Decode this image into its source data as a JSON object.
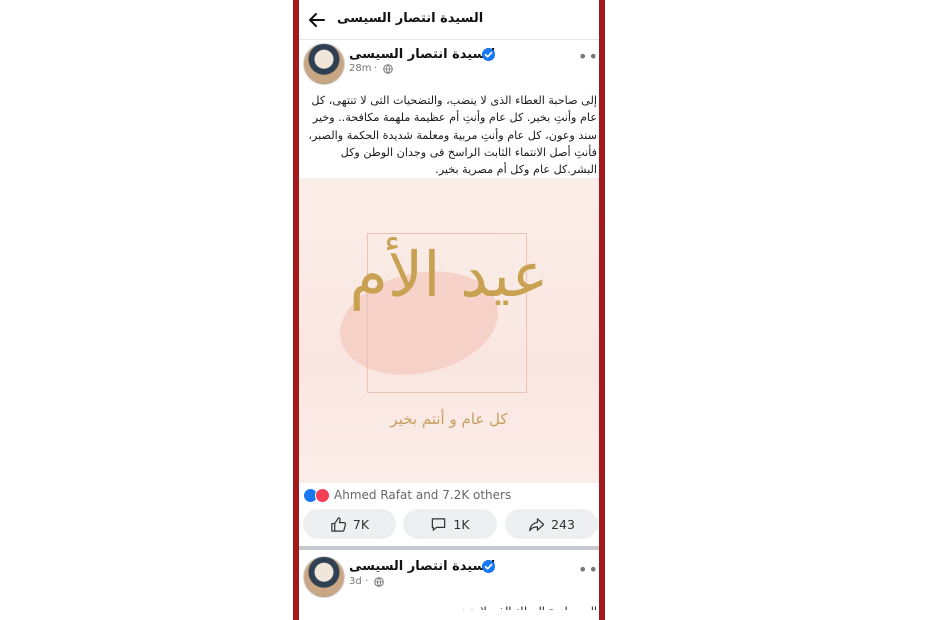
{
  "topbar": {
    "title": "السيدة انتصار السيسى"
  },
  "posts": [
    {
      "author": "السيدة انتصار السيسى",
      "time": "28m",
      "separator": "·",
      "more": "•••",
      "text": "إلى صاحبة العطاء الذى لا ينضب، والتضحيات التى لا تنتهى، كل عام وأنتِ بخير. كل عام وأنتِ أم عظيمة ملهمة مكافحة.. وخير سند وعون، كل عام وأنتِ مربية ومعلمة شديدة الحكمة والصبر، فأنتِ أصل الانتماء الثابت الراسخ فى وجدان الوطن وكل البشر.كل عام وكل أم مصرية بخير.",
      "image": {
        "calligraphy": "عيد الأم",
        "greeting": "كل عام و أنتم بخير"
      },
      "reactions_text": "Ahmed Rafat and 7.2K others",
      "actions": {
        "likes": "7K",
        "comments": "1K",
        "shares": "243"
      }
    },
    {
      "author": "السيدة انتصار السيسى",
      "time": "3d",
      "separator": "·",
      "more": "•••",
      "text_partial": "إلى صاحبة العطاء الذى لا ينضب"
    }
  ],
  "colors": {
    "bezel": "#a3191c",
    "accent_blue": "#1877f2",
    "love_red": "#f33e58",
    "gold": "#c9a152",
    "card_bg": "#fbeee9"
  },
  "icons": [
    "back-arrow-icon",
    "verified-icon",
    "globe-icon",
    "more-icon",
    "like-icon",
    "comment-icon",
    "share-icon"
  ]
}
